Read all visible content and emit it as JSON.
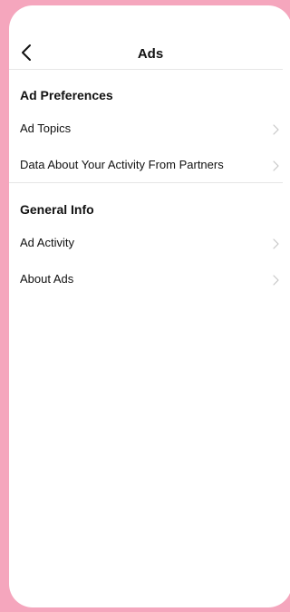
{
  "header": {
    "title": "Ads",
    "back_icon": "chevron-left-icon"
  },
  "sections": [
    {
      "title": "Ad Preferences",
      "items": [
        {
          "label": "Ad Topics",
          "icon": "chevron-right-icon"
        },
        {
          "label": "Data About Your Activity From Partners",
          "icon": "chevron-right-icon"
        }
      ]
    },
    {
      "title": "General Info",
      "items": [
        {
          "label": "Ad Activity",
          "icon": "chevron-right-icon"
        },
        {
          "label": "About Ads",
          "icon": "chevron-right-icon"
        }
      ]
    }
  ],
  "colors": {
    "background": "#f5a6bd",
    "card": "#ffffff",
    "divider": "#e6e6e6",
    "chevron": "#c7c7c7"
  }
}
